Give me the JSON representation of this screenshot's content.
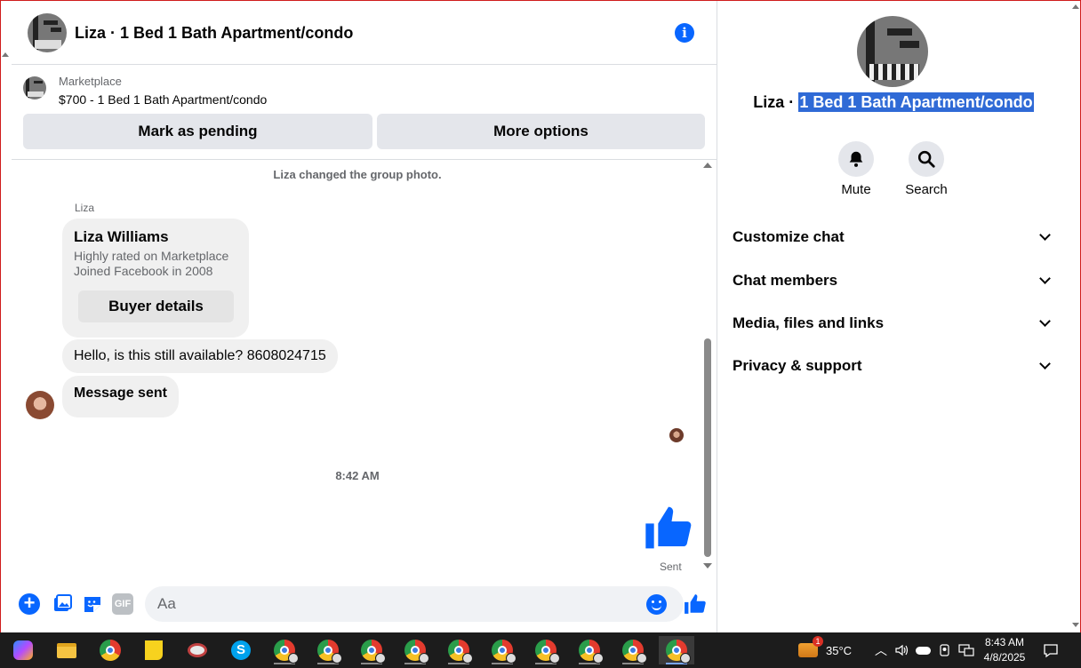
{
  "chat": {
    "header_title": "Liza · 1 Bed 1 Bath Apartment/condo",
    "info_icon": "info-icon",
    "marketplace_label": "Marketplace",
    "listing": "$700 - 1 Bed 1 Bath Apartment/condo",
    "mark_pending": "Mark as pending",
    "more_options": "More options"
  },
  "messages": {
    "system": "Liza changed the group photo.",
    "sender": "Liza",
    "buyer_name": "Liza Williams",
    "buyer_line1": "Highly rated on Marketplace",
    "buyer_line2": "Joined Facebook in 2008",
    "buyer_details": "Buyer details",
    "hello": "Hello, is this still available? 8608024715",
    "message_sent": "Message sent",
    "timestamp": "8:42 AM",
    "sent_status": "Sent"
  },
  "composer": {
    "placeholder": "Aa",
    "gif": "GIF"
  },
  "details": {
    "name": "Liza · ",
    "listing_selected": "1 Bed 1 Bath Apartment/condo",
    "mute": "Mute",
    "search": "Search",
    "sections": [
      "Customize chat",
      "Chat members",
      "Media, files and links",
      "Privacy & support"
    ]
  },
  "taskbar": {
    "weather_badge": "1",
    "temperature": "35°C",
    "time": "8:43 AM",
    "date": "4/8/2025"
  },
  "colors": {
    "accent": "#0866ff",
    "selection": "#2f6ad6"
  }
}
